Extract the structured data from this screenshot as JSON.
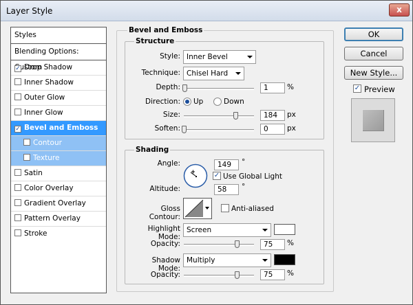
{
  "window": {
    "title": "Layer Style",
    "close_glyph": "x"
  },
  "styles_list": {
    "header": "Styles",
    "blending_options": "Blending Options: Custom",
    "items": [
      {
        "label": "Drop Shadow",
        "checked": true
      },
      {
        "label": "Inner Shadow",
        "checked": false
      },
      {
        "label": "Outer Glow",
        "checked": false
      },
      {
        "label": "Inner Glow",
        "checked": false
      },
      {
        "label": "Bevel and Emboss",
        "checked": true,
        "selected": true
      },
      {
        "label": "Contour",
        "checked": false,
        "sub": true
      },
      {
        "label": "Texture",
        "checked": false,
        "sub": true
      },
      {
        "label": "Satin",
        "checked": false
      },
      {
        "label": "Color Overlay",
        "checked": false
      },
      {
        "label": "Gradient Overlay",
        "checked": false
      },
      {
        "label": "Pattern Overlay",
        "checked": false
      },
      {
        "label": "Stroke",
        "checked": false
      }
    ]
  },
  "bevel": {
    "section_title": "Bevel and Emboss",
    "structure": {
      "title": "Structure",
      "style_label": "Style:",
      "style_value": "Inner Bevel",
      "technique_label": "Technique:",
      "technique_value": "Chisel Hard",
      "depth_label": "Depth:",
      "depth_value": "1",
      "depth_unit": "%",
      "depth_slider": 0.01,
      "direction_label": "Direction:",
      "direction_up": "Up",
      "direction_down": "Down",
      "direction_selected": "Up",
      "size_label": "Size:",
      "size_value": "184",
      "size_unit": "px",
      "size_slider": 0.74,
      "soften_label": "Soften:",
      "soften_value": "0",
      "soften_unit": "px",
      "soften_slider": 0.0
    },
    "shading": {
      "title": "Shading",
      "angle_label": "Angle:",
      "angle_value": "149",
      "angle_unit": "°",
      "use_global_light": "Use Global Light",
      "use_global_light_checked": true,
      "altitude_label": "Altitude:",
      "altitude_value": "58",
      "altitude_unit": "°",
      "gloss_contour_label": "Gloss Contour:",
      "anti_aliased": "Anti-aliased",
      "anti_aliased_checked": false,
      "highlight_mode_label": "Highlight Mode:",
      "highlight_mode_value": "Screen",
      "highlight_color": "#ffffff",
      "highlight_opacity_label": "Opacity:",
      "highlight_opacity_value": "75",
      "highlight_opacity_unit": "%",
      "highlight_opacity_slider": 0.75,
      "shadow_mode_label": "Shadow Mode:",
      "shadow_mode_value": "Multiply",
      "shadow_color": "#000000",
      "shadow_opacity_label": "Opacity:",
      "shadow_opacity_value": "75",
      "shadow_opacity_unit": "%",
      "shadow_opacity_slider": 0.75
    }
  },
  "buttons": {
    "ok": "OK",
    "cancel": "Cancel",
    "new_style": "New Style...",
    "preview": "Preview",
    "preview_checked": true
  },
  "colors": {
    "selection": "#3399ff",
    "sub_selection": "#8fc1f5",
    "window_bg": "#f0f0f0"
  }
}
